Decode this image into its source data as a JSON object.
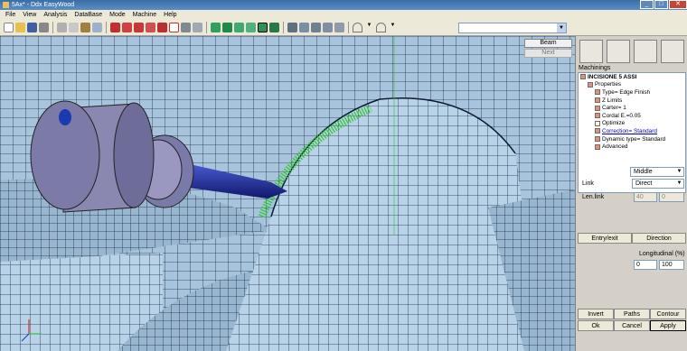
{
  "window": {
    "title": "5Ax* - Ddx EasyWood"
  },
  "menu": [
    "File",
    "View",
    "Analysis",
    "DataBase",
    "Mode",
    "Machine",
    "Help"
  ],
  "toolbar_icons": [
    "new-icon",
    "open-icon",
    "save-icon",
    "print-icon",
    "cut-icon",
    "copy-icon",
    "paste-icon",
    "undo-icon",
    "measure-icon",
    "tool-icon",
    "drill-icon",
    "mill-icon",
    "knife-icon",
    "saw-icon",
    "clamp-icon",
    "view-top-icon",
    "view-front-icon",
    "view-left-icon",
    "view-iso-icon",
    "view-shaded-icon",
    "view-wire-icon",
    "fit-icon",
    "zoom-icon",
    "rotate-icon",
    "pan-icon",
    "home-icon",
    "dropdown-icon",
    "arc-icon"
  ],
  "viewport": {
    "beam_label": "Beam",
    "next_label": "Next"
  },
  "panel": {
    "section_title": "Machinings",
    "tree": [
      {
        "label": "INCISIONE 5 ASSI",
        "style": "bold"
      },
      {
        "label": "Properties"
      },
      {
        "label": "Type= Edge Finish"
      },
      {
        "label": "Z Limits"
      },
      {
        "label": "Carter= 1"
      },
      {
        "label": "Cordal E.=0.05"
      },
      {
        "label": "Optimize"
      },
      {
        "label": "Correction= Standard",
        "style": "link"
      },
      {
        "label": "Dynamic type= Standard"
      },
      {
        "label": "Advanced"
      }
    ],
    "middle": "Middle",
    "link_label": "Link",
    "link_value": "Direct",
    "lenlink_label": "Len.link",
    "lenlink_a": "40",
    "lenlink_b": "0",
    "entry_exit": "Entry/exit",
    "direction": "Direction",
    "longitudinal_label": "Longitudinal (%)",
    "long_a": "0",
    "long_b": "100",
    "invert": "Invert",
    "paths": "Paths",
    "contour": "Contour",
    "ok": "Ok",
    "cancel": "Cancel",
    "apply": "Apply"
  }
}
